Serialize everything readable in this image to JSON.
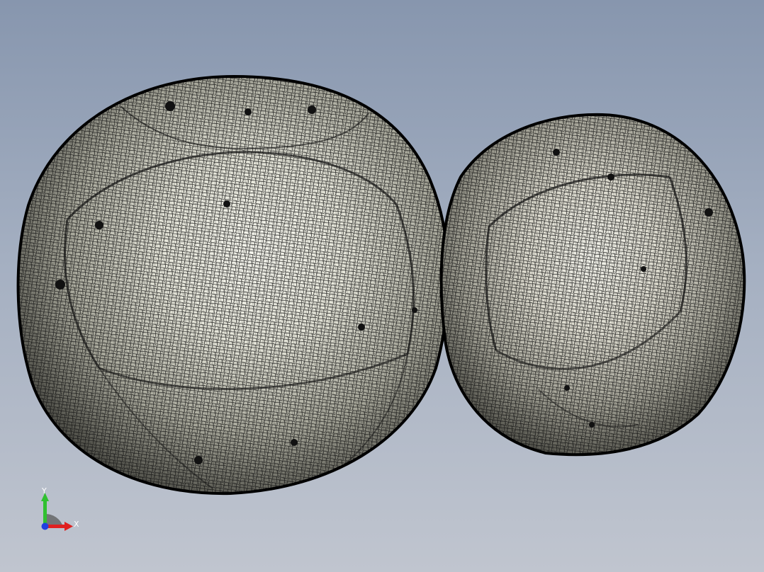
{
  "viewport": {
    "background_top": "#8796ae",
    "background_bottom": "#c0c5cf"
  },
  "model": {
    "mesh_color": "#0d0d0d",
    "surface_highlight": "#f4f4ea",
    "surface_shadow": "#55554d",
    "bodies": [
      {
        "name": "large-sphere-mesh"
      },
      {
        "name": "small-sphere-mesh"
      }
    ]
  },
  "triad": {
    "x_label": "X",
    "y_label": "Y",
    "x_color": "#e02020",
    "y_color": "#30c030",
    "z_color": "#2040e0"
  }
}
